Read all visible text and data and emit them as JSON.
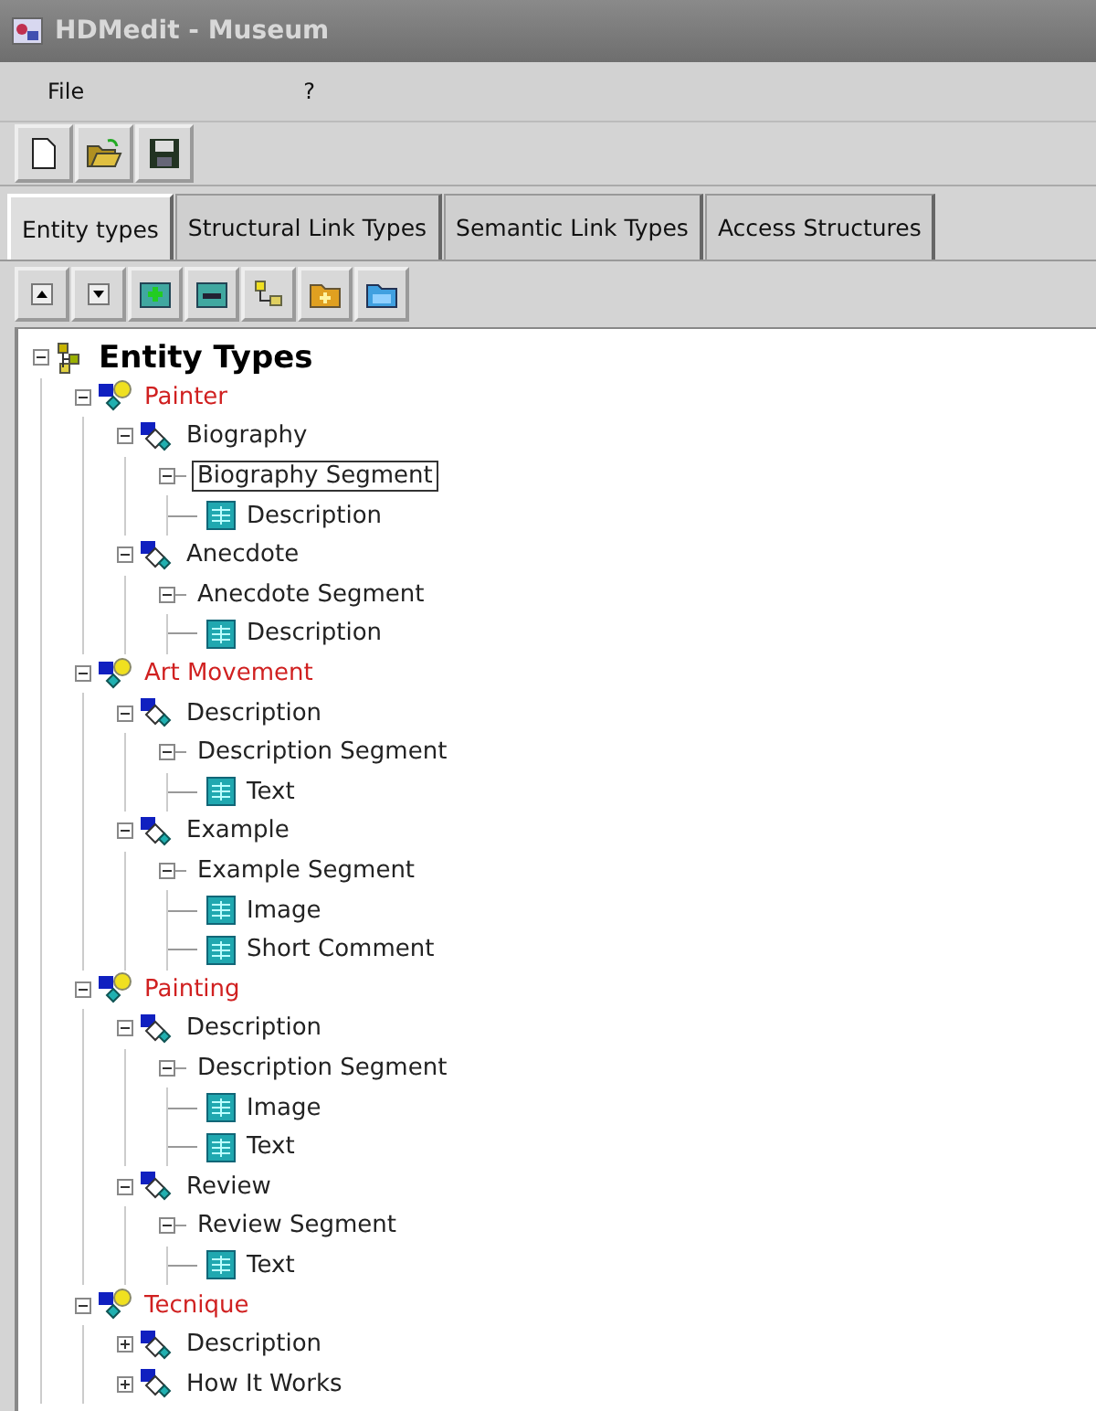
{
  "window": {
    "title": "HDMedit - Museum"
  },
  "menu": [
    "File",
    "?"
  ],
  "toolbar": [
    {
      "kind": "new"
    },
    {
      "kind": "open"
    },
    {
      "kind": "save"
    }
  ],
  "tabs": [
    {
      "label": "Entity types",
      "selected": true
    },
    {
      "label": "Structural Link Types",
      "selected": false
    },
    {
      "label": "Semantic Link Types",
      "selected": false
    },
    {
      "label": "Access Structures",
      "selected": false
    }
  ],
  "tree_toolbar": [
    {
      "kind": "up"
    },
    {
      "kind": "down"
    },
    {
      "kind": "add"
    },
    {
      "kind": "remove"
    },
    {
      "kind": "link"
    },
    {
      "kind": "folder"
    },
    {
      "kind": "folder-blue"
    }
  ],
  "tree": {
    "kind": "root",
    "label": "Entity Types",
    "expanded": true,
    "children": [
      {
        "kind": "entity",
        "label": "Painter",
        "expanded": true,
        "children": [
          {
            "kind": "component",
            "label": "Biography",
            "expanded": true,
            "children": [
              {
                "kind": "segment",
                "label": "Biography Segment",
                "expanded": true,
                "selected": true,
                "children": [
                  {
                    "kind": "field",
                    "label": "Description"
                  }
                ]
              }
            ]
          },
          {
            "kind": "component",
            "label": "Anecdote",
            "expanded": true,
            "children": [
              {
                "kind": "segment",
                "label": "Anecdote Segment",
                "expanded": true,
                "selected": false,
                "children": [
                  {
                    "kind": "field",
                    "label": "Description"
                  }
                ]
              }
            ]
          }
        ]
      },
      {
        "kind": "entity",
        "label": "Art Movement",
        "expanded": true,
        "children": [
          {
            "kind": "component",
            "label": "Description",
            "expanded": true,
            "children": [
              {
                "kind": "segment",
                "label": "Description Segment",
                "expanded": true,
                "selected": false,
                "children": [
                  {
                    "kind": "field",
                    "label": "Text"
                  }
                ]
              }
            ]
          },
          {
            "kind": "component",
            "label": "Example",
            "expanded": true,
            "children": [
              {
                "kind": "segment",
                "label": "Example Segment",
                "expanded": true,
                "selected": false,
                "children": [
                  {
                    "kind": "field",
                    "label": "Image"
                  },
                  {
                    "kind": "field",
                    "label": "Short Comment"
                  }
                ]
              }
            ]
          }
        ]
      },
      {
        "kind": "entity",
        "label": "Painting",
        "expanded": true,
        "children": [
          {
            "kind": "component",
            "label": "Description",
            "expanded": true,
            "children": [
              {
                "kind": "segment",
                "label": "Description Segment",
                "expanded": true,
                "selected": false,
                "children": [
                  {
                    "kind": "field",
                    "label": "Image"
                  },
                  {
                    "kind": "field",
                    "label": "Text"
                  }
                ]
              }
            ]
          },
          {
            "kind": "component",
            "label": "Review",
            "expanded": true,
            "children": [
              {
                "kind": "segment",
                "label": "Review Segment",
                "expanded": true,
                "selected": false,
                "children": [
                  {
                    "kind": "field",
                    "label": "Text"
                  }
                ]
              }
            ]
          }
        ]
      },
      {
        "kind": "entity",
        "label": "Tecnique",
        "expanded": true,
        "children": [
          {
            "kind": "component",
            "label": "Description",
            "expanded": false
          },
          {
            "kind": "component",
            "label": "How It Works",
            "expanded": false
          }
        ]
      }
    ]
  }
}
